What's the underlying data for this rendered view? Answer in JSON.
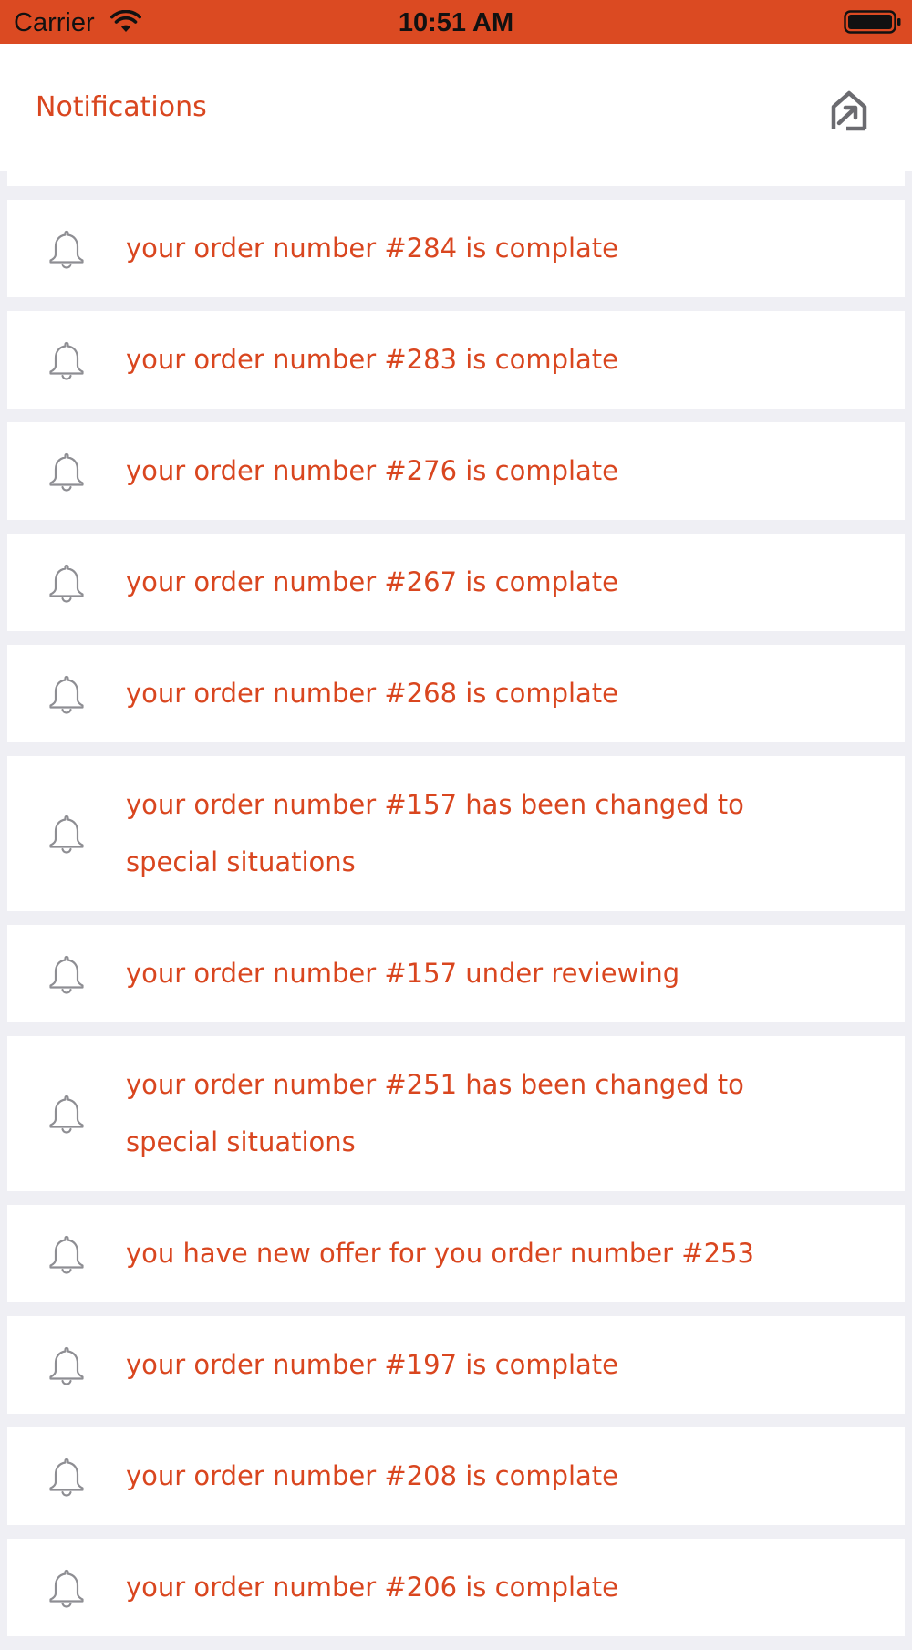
{
  "status_bar": {
    "carrier": "Carrier",
    "time": "10:51 AM",
    "icons": [
      "wifi-icon",
      "battery-icon"
    ]
  },
  "nav": {
    "title": "Notifications",
    "home_icon": "home-arrow-icon"
  },
  "colors": {
    "accent": "#db4a22",
    "text_accent": "#d9461f",
    "background": "#efeff4",
    "icon_gray": "#8e8e93"
  },
  "notifications": [
    {
      "text": "your order number #284 is complate",
      "icon": "bell-icon"
    },
    {
      "text": "your order number #283 is complate",
      "icon": "bell-icon"
    },
    {
      "text": "your order number #276 is complate",
      "icon": "bell-icon"
    },
    {
      "text": "your order number #267 is complate",
      "icon": "bell-icon"
    },
    {
      "text": "your order number #268 is complate",
      "icon": "bell-icon"
    },
    {
      "text": "your order number #157 has been changed to special situations",
      "icon": "bell-icon"
    },
    {
      "text": "your order number #157 under reviewing",
      "icon": "bell-icon"
    },
    {
      "text": "your order number #251 has been changed to special situations",
      "icon": "bell-icon"
    },
    {
      "text": "you have new offer for you order number #253",
      "icon": "bell-icon"
    },
    {
      "text": "your order number #197 is complate",
      "icon": "bell-icon"
    },
    {
      "text": "your order number #208 is complate",
      "icon": "bell-icon"
    },
    {
      "text": "your order number #206 is complate",
      "icon": "bell-icon"
    }
  ]
}
